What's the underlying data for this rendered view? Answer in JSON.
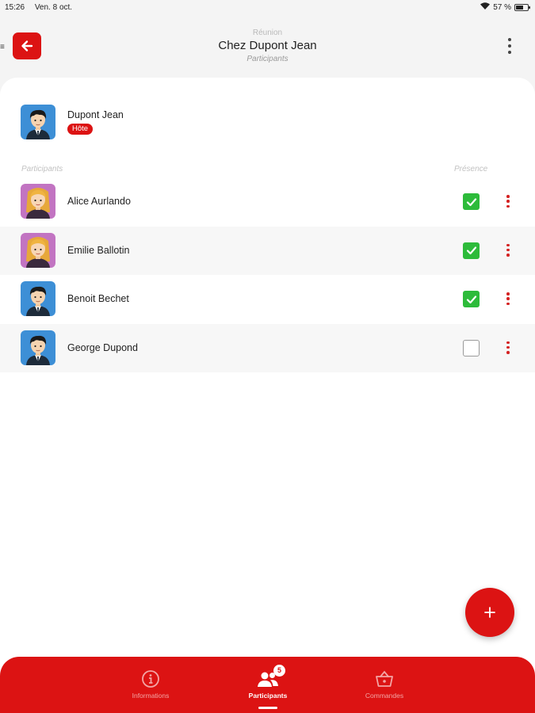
{
  "status_bar": {
    "time": "15:26",
    "date": "Ven. 8 oct.",
    "battery": "57 %"
  },
  "header": {
    "subtitle": "Réunion",
    "title": "Chez Dupont Jean",
    "section": "Participants",
    "back_icon": "arrow-left-icon",
    "menu_icon": "more-vertical-icon"
  },
  "host": {
    "name": "Dupont Jean",
    "badge": "Hôte",
    "avatar": "male"
  },
  "list_headers": {
    "participants": "Participants",
    "presence": "Présence"
  },
  "participants": [
    {
      "name": "Alice Aurlando",
      "avatar": "female",
      "present": true
    },
    {
      "name": "Emilie Ballotin",
      "avatar": "female",
      "present": true
    },
    {
      "name": "Benoit Bechet",
      "avatar": "male",
      "present": true
    },
    {
      "name": "George Dupond",
      "avatar": "male",
      "present": false
    }
  ],
  "fab": {
    "icon": "plus-icon"
  },
  "bottom_nav": {
    "items": [
      {
        "label": "Informations",
        "icon": "info-icon",
        "active": false
      },
      {
        "label": "Participants",
        "icon": "people-icon",
        "active": true,
        "badge": "5"
      },
      {
        "label": "Commandes",
        "icon": "basket-icon",
        "active": false
      }
    ]
  },
  "colors": {
    "accent": "#dc1313",
    "check": "#2dbb3a",
    "male_bg": "#3d8fd6",
    "female_bg": "#c274c2"
  }
}
